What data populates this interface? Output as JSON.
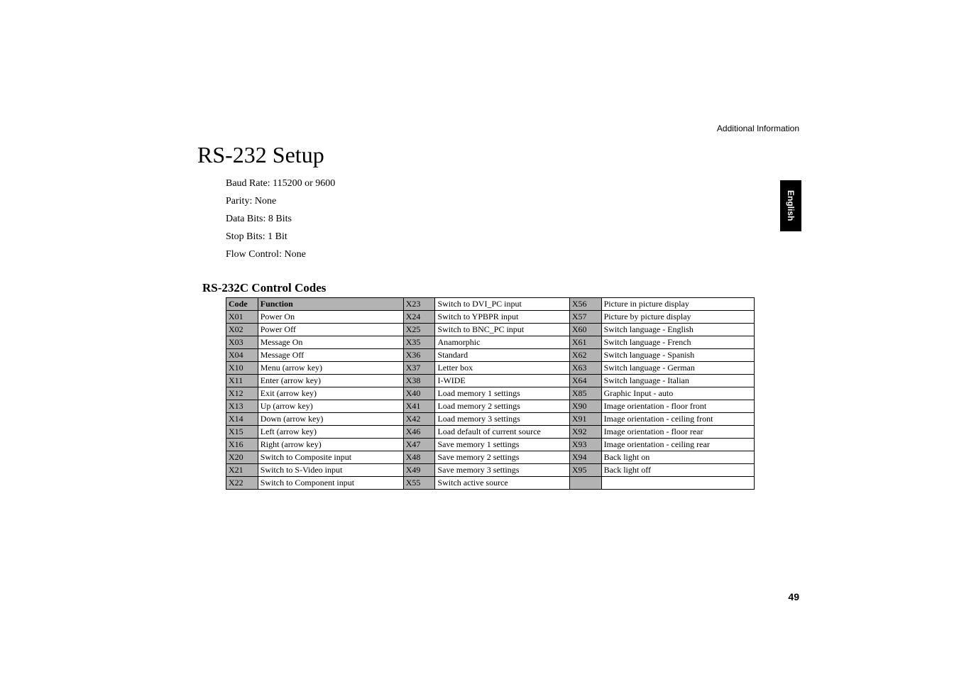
{
  "header_right": "Additional Information",
  "lang_tab": "English",
  "title": "RS-232 Setup",
  "settings": [
    "Baud Rate: 115200 or 9600",
    "Parity: None",
    "Data Bits: 8 Bits",
    "Stop Bits: 1 Bit",
    "Flow Control: None"
  ],
  "subheading": "RS-232C Control Codes",
  "table": {
    "header": {
      "code": "Code",
      "function": "Function"
    },
    "col1": [
      {
        "code": "X01",
        "func": "Power On"
      },
      {
        "code": "X02",
        "func": "Power Off"
      },
      {
        "code": "X03",
        "func": "Message On"
      },
      {
        "code": "X04",
        "func": "Message Off"
      },
      {
        "code": "X10",
        "func": "Menu (arrow key)"
      },
      {
        "code": "X11",
        "func": "Enter (arrow key)"
      },
      {
        "code": "X12",
        "func": "Exit (arrow key)"
      },
      {
        "code": "X13",
        "func": "Up (arrow key)"
      },
      {
        "code": "X14",
        "func": "Down (arrow key)"
      },
      {
        "code": "X15",
        "func": "Left (arrow key)"
      },
      {
        "code": "X16",
        "func": "Right (arrow key)"
      },
      {
        "code": "X20",
        "func": "Switch to Composite input"
      },
      {
        "code": "X21",
        "func": "Switch to S-Video input"
      },
      {
        "code": "X22",
        "func": "Switch to Component input"
      }
    ],
    "col2": [
      {
        "code": "X23",
        "func": "Switch to DVI_PC input"
      },
      {
        "code": "X24",
        "func": "Switch to YPBPR input"
      },
      {
        "code": "X25",
        "func": "Switch to BNC_PC input"
      },
      {
        "code": "X35",
        "func": "Anamorphic"
      },
      {
        "code": "X36",
        "func": "Standard"
      },
      {
        "code": "X37",
        "func": "Letter box"
      },
      {
        "code": "X38",
        "func": "I-WIDE"
      },
      {
        "code": "X40",
        "func": "Load memory 1 settings"
      },
      {
        "code": "X41",
        "func": "Load memory 2 settings"
      },
      {
        "code": "X42",
        "func": "Load memory 3 settings"
      },
      {
        "code": "X46",
        "func": "Load default of current source"
      },
      {
        "code": "X47",
        "func": "Save memory 1 settings"
      },
      {
        "code": "X48",
        "func": "Save memory 2 settings"
      },
      {
        "code": "X49",
        "func": "Save memory 3 settings"
      },
      {
        "code": "X55",
        "func": "Switch active source"
      }
    ],
    "col3": [
      {
        "code": "X56",
        "func": "Picture in picture display"
      },
      {
        "code": "X57",
        "func": "Picture by picture display"
      },
      {
        "code": "X60",
        "func": "Switch language - English"
      },
      {
        "code": "X61",
        "func": "Switch language - French"
      },
      {
        "code": "X62",
        "func": "Switch language - Spanish"
      },
      {
        "code": "X63",
        "func": "Switch language - German"
      },
      {
        "code": "X64",
        "func": "Switch language - Italian"
      },
      {
        "code": "X85",
        "func": "Graphic Input - auto"
      },
      {
        "code": "X90",
        "func": "Image orientation - floor front"
      },
      {
        "code": "X91",
        "func": "Image orientation - ceiling front"
      },
      {
        "code": "X92",
        "func": "Image orientation - floor rear"
      },
      {
        "code": "X93",
        "func": "Image orientation - ceiling rear"
      },
      {
        "code": "X94",
        "func": "Back light on"
      },
      {
        "code": "X95",
        "func": "Back light off"
      },
      {
        "code": "",
        "func": ""
      }
    ]
  },
  "page_num": "49"
}
